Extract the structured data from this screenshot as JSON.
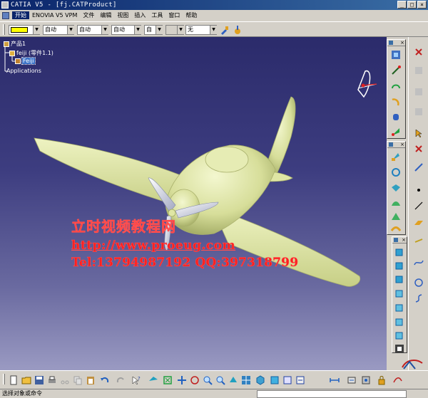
{
  "window": {
    "title": "CATIA V5 - [fj.CATProduct]",
    "controls": [
      "_",
      "□",
      "×"
    ]
  },
  "menu": {
    "items": [
      "开始",
      "ENOVIA V5 VPM",
      "文件",
      "编辑",
      "视图",
      "插入",
      "工具",
      "窗口",
      "帮助"
    ]
  },
  "properties": {
    "color": "#ffff00",
    "combos": [
      "自动",
      "自动",
      "自动",
      "自",
      "无"
    ]
  },
  "tree": {
    "root": "产品1",
    "child": "feiji (零件1.1)",
    "selected": "Feiji",
    "applications": "Applications"
  },
  "watermark": {
    "line1": "立时视频教程网",
    "line2": "http://www.proeug.com",
    "line3": "Tel:13794987192   QQ:397318799"
  },
  "status": {
    "text": "选择对象或命令"
  },
  "colors": {
    "plane": "#dfe6a4",
    "plane_shadow": "#9ea760",
    "watermark": "#ff2020"
  }
}
